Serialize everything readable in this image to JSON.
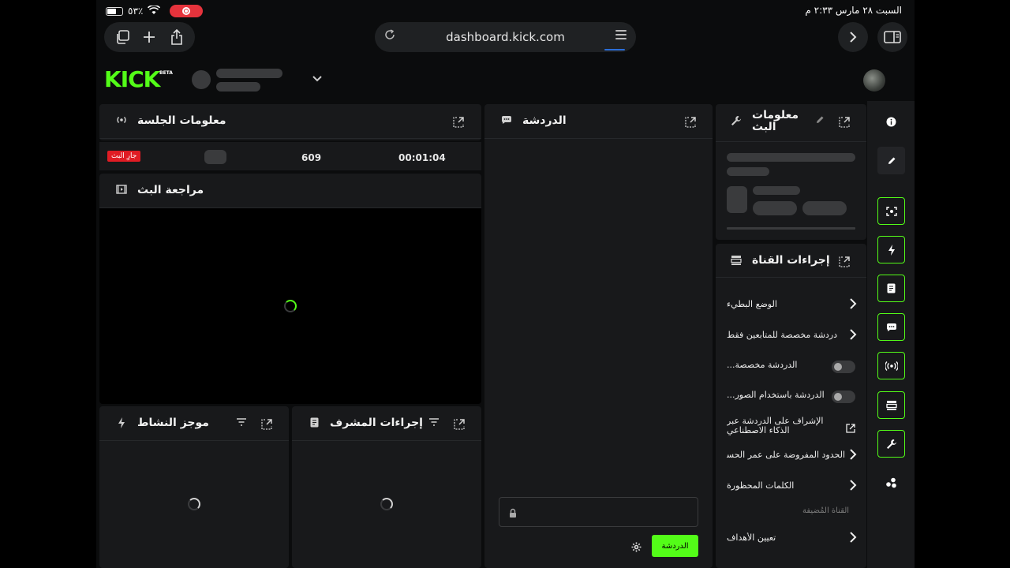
{
  "status_bar": {
    "battery_pct": "٥٣٪",
    "datetime": "السبت ٢٨ مارس   ٢:٣٣ م"
  },
  "browser": {
    "url": "dashboard.kick.com"
  },
  "header": {
    "logo_text": "KICK",
    "logo_badge": "BETA"
  },
  "session_info": {
    "title": "معلومات الجلسة",
    "status_badge": "جارِ البث",
    "viewers": "609",
    "duration": "00:01:04"
  },
  "stream_review": {
    "title": "مراجعة البث"
  },
  "activity_feed": {
    "title": "موجز النشاط"
  },
  "mod_actions": {
    "title": "إجراءات المشرف"
  },
  "chat": {
    "title": "الدردشة",
    "send_label": "الدردشة"
  },
  "stream_info": {
    "title": "معلومات البث"
  },
  "channel_actions": {
    "title": "إجراءات القناة",
    "items": [
      {
        "label": "الوضع البطيء",
        "control": "chevron"
      },
      {
        "label": "دردشة مخصصة للمتابعين فقط",
        "control": "chevron"
      },
      {
        "label": "الدردشة مخصصة...",
        "control": "toggle"
      },
      {
        "label": "الدردشة باستخدام الصور...",
        "control": "toggle"
      },
      {
        "label": "الإشراف على الدردشة عبر الذكاء الاصطناعي",
        "control": "external"
      },
      {
        "label": "الحدود المفروضة على عمر الحساب",
        "control": "chevron"
      },
      {
        "label": "الكلمات المحظورة",
        "control": "chevron"
      }
    ],
    "section_header": "القناة المُضيفة",
    "goals_label": "تعيين الأهداف"
  },
  "colors": {
    "accent": "#53fc18",
    "live": "#e01c24",
    "panel": "#18191b"
  }
}
